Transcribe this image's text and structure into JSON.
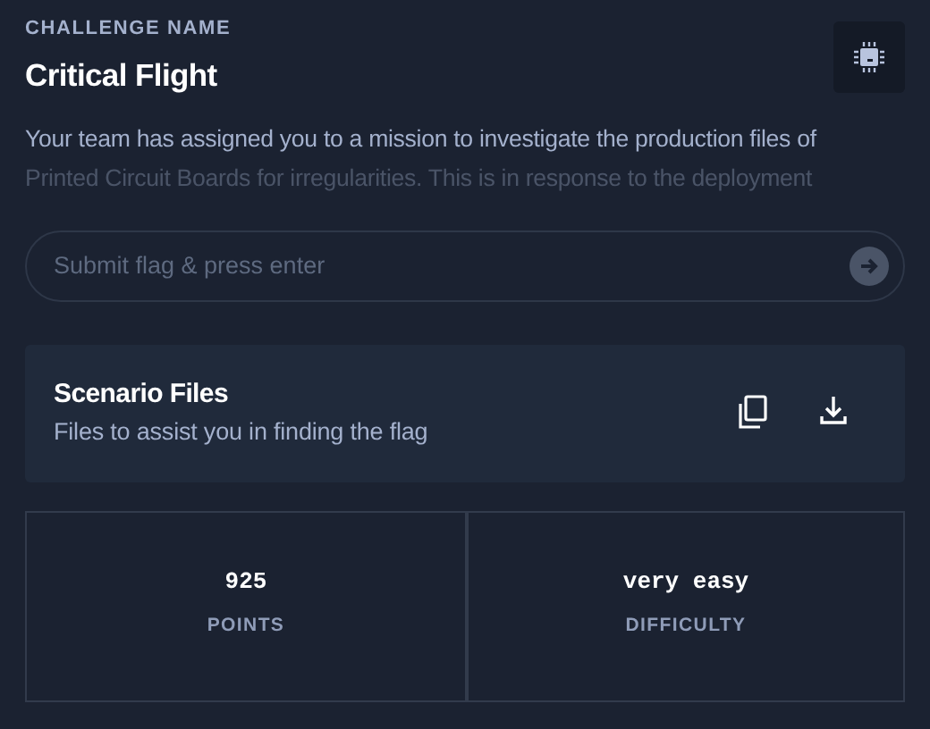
{
  "challenge": {
    "label": "CHALLENGE NAME",
    "title": "Critical Flight",
    "description": "Your team has assigned you to a mission to investigate the production files of Printed Circuit Boards for irregularities. This is in response to the deployment"
  },
  "flag_input": {
    "placeholder": "Submit flag & press enter"
  },
  "files": {
    "title": "Scenario Files",
    "subtitle": "Files to assist you in finding the flag"
  },
  "stats": [
    {
      "value": "925",
      "label": "POINTS"
    },
    {
      "value": "very easy",
      "label": "DIFFICULTY"
    }
  ]
}
